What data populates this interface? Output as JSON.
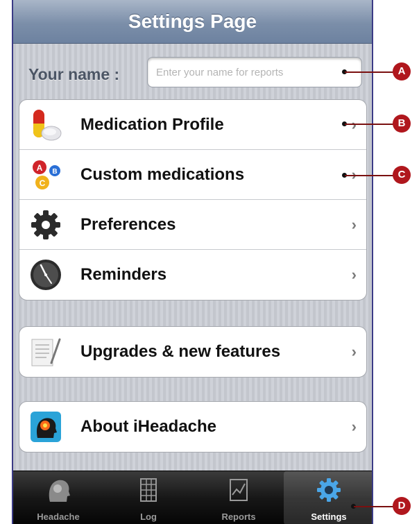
{
  "navbar": {
    "title": "Settings Page"
  },
  "name_field": {
    "label": "Your name :",
    "placeholder": "Enter your name for reports",
    "value": ""
  },
  "groups": [
    {
      "items": [
        {
          "label": "Medication Profile",
          "icon": "pill-icon"
        },
        {
          "label": "Custom medications",
          "icon": "abc-pills-icon"
        },
        {
          "label": "Preferences",
          "icon": "gear-icon"
        },
        {
          "label": "Reminders",
          "icon": "clock-icon"
        }
      ]
    },
    {
      "items": [
        {
          "label": "Upgrades & new features",
          "icon": "document-icon"
        }
      ]
    },
    {
      "items": [
        {
          "label": "About iHeadache",
          "icon": "head-icon"
        }
      ]
    }
  ],
  "tabs": [
    {
      "label": "Headache",
      "icon": "head-icon"
    },
    {
      "label": "Log",
      "icon": "log-icon"
    },
    {
      "label": "Reports",
      "icon": "chart-icon"
    },
    {
      "label": "Settings",
      "icon": "gear-icon",
      "active": true
    }
  ],
  "callouts": [
    "A",
    "B",
    "C",
    "D"
  ],
  "colors": {
    "callout": "#b0171d",
    "navbar": "#7b8ea9",
    "tabbar": "#171717"
  }
}
